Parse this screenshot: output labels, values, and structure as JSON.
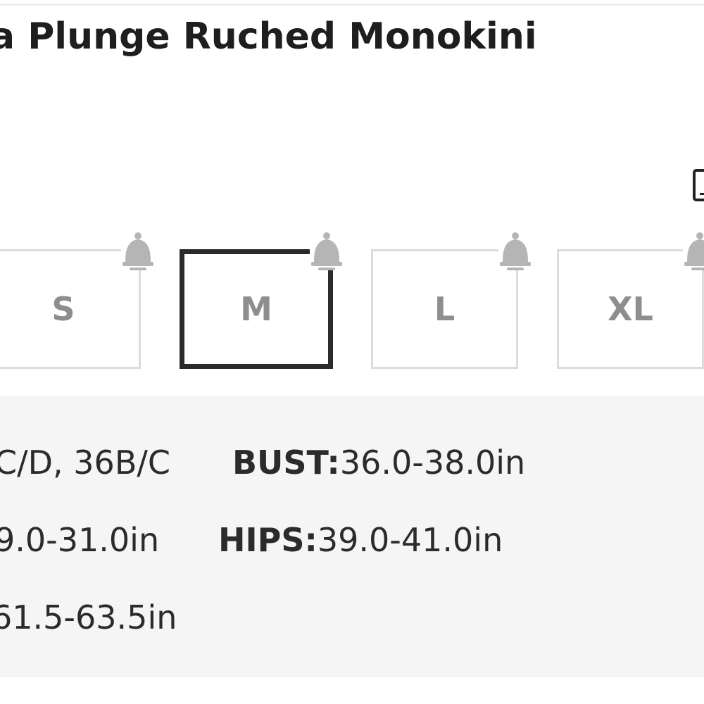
{
  "product": {
    "title": "a Plunge Ruched Monokini"
  },
  "size_chart": {
    "icon": "ruler-icon"
  },
  "sizes": [
    {
      "label": "S",
      "selected": false,
      "notify_icon": "bell-icon"
    },
    {
      "label": "M",
      "selected": true,
      "notify_icon": "bell-icon"
    },
    {
      "label": "L",
      "selected": false,
      "notify_icon": "bell-icon"
    },
    {
      "label": "XL",
      "selected": false,
      "notify_icon": "bell-icon"
    }
  ],
  "measurements": {
    "cup": "C/D, 36B/C",
    "bust_label": "BUST:",
    "bust_value": "36.0-38.0in",
    "waist": "9.0-31.0in",
    "hips_label": "HIPS:",
    "hips_value": "39.0-41.0in",
    "height": "61.5-63.5in"
  },
  "colors": {
    "selected_border": "#2b2b2b",
    "unselected_border": "#dcdcdc",
    "size_text": "#8e8e8e",
    "bell": "#b5b5b5",
    "panel_bg": "#f5f5f5"
  }
}
